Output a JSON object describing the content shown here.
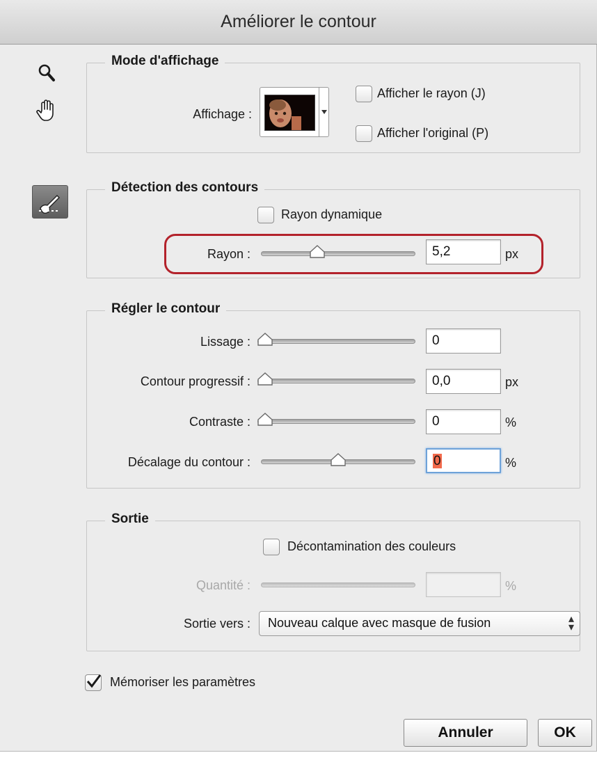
{
  "window": {
    "title": "Améliorer le contour"
  },
  "tools": [
    {
      "name": "zoom-icon"
    },
    {
      "name": "hand-icon"
    },
    {
      "name": "refine-radius-brush-icon"
    }
  ],
  "display_mode": {
    "heading": "Mode d'affichage",
    "display_label": "Affichage :",
    "show_radius_label": "Afficher le rayon (J)",
    "show_original_label": "Afficher l'original (P)",
    "show_radius_checked": false,
    "show_original_checked": false
  },
  "edge_detection": {
    "heading": "Détection des contours",
    "smart_radius_label": "Rayon dynamique",
    "smart_radius_checked": false,
    "radius_label": "Rayon :",
    "radius_value": "5,2",
    "radius_unit": "px",
    "radius_slider_fraction": 0.35
  },
  "adjust_edge": {
    "heading": "Régler le contour",
    "smooth_label": "Lissage :",
    "smooth_value": "0",
    "smooth_slider_fraction": 0.0,
    "feather_label": "Contour progressif :",
    "feather_value": "0,0",
    "feather_unit": "px",
    "feather_slider_fraction": 0.0,
    "contrast_label": "Contraste :",
    "contrast_value": "0",
    "contrast_unit": "%",
    "contrast_slider_fraction": 0.0,
    "shift_label": "Décalage du contour :",
    "shift_value": "0",
    "shift_unit": "%",
    "shift_slider_fraction": 0.5
  },
  "output": {
    "heading": "Sortie",
    "decontaminate_label": "Décontamination des couleurs",
    "decontaminate_checked": false,
    "amount_label": "Quantité :",
    "amount_value": "",
    "amount_unit": "%",
    "amount_slider_fraction": 0.5,
    "output_to_label": "Sortie vers :",
    "output_to_value": "Nouveau calque avec masque de fusion"
  },
  "remember": {
    "label": "Mémoriser les paramètres",
    "checked": true
  },
  "buttons": {
    "cancel": "Annuler",
    "ok": "OK"
  },
  "colors": {
    "highlight": "#b3222b",
    "focus": "#6ea2d9",
    "selection": "#f26a4c"
  }
}
